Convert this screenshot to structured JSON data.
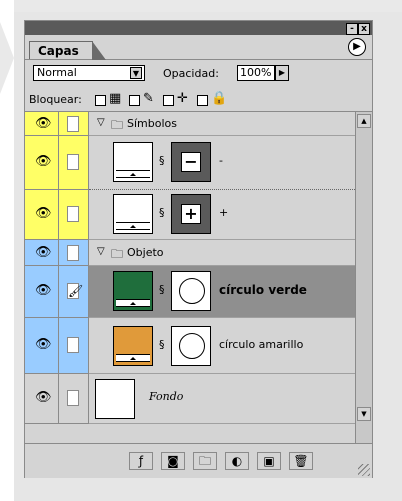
{
  "window": {
    "minimize": "-",
    "close": "x"
  },
  "tab": {
    "label": "Capas",
    "menu_icon": "▶"
  },
  "blend": {
    "mode": "Normal",
    "opacity_label": "Opacidad:",
    "opacity_value": "100%"
  },
  "lock": {
    "label": "Bloquear:"
  },
  "groups": [
    {
      "name": "Símbolos",
      "color": "#ffff66"
    },
    {
      "name": "Objeto",
      "color": "#99ccff"
    }
  ],
  "layers": [
    {
      "name": "-",
      "symbol": "−"
    },
    {
      "name": "+",
      "symbol": "+"
    },
    {
      "name": "círculo verde",
      "fill": "#1f6e3c",
      "selected": true
    },
    {
      "name": "círculo amarillo",
      "fill": "#e09a3a"
    },
    {
      "name": "Fondo"
    }
  ],
  "icons": {
    "eye": "eye-icon",
    "brush": "brush-icon",
    "chain": "chain-icon",
    "folder": "folder-icon"
  }
}
